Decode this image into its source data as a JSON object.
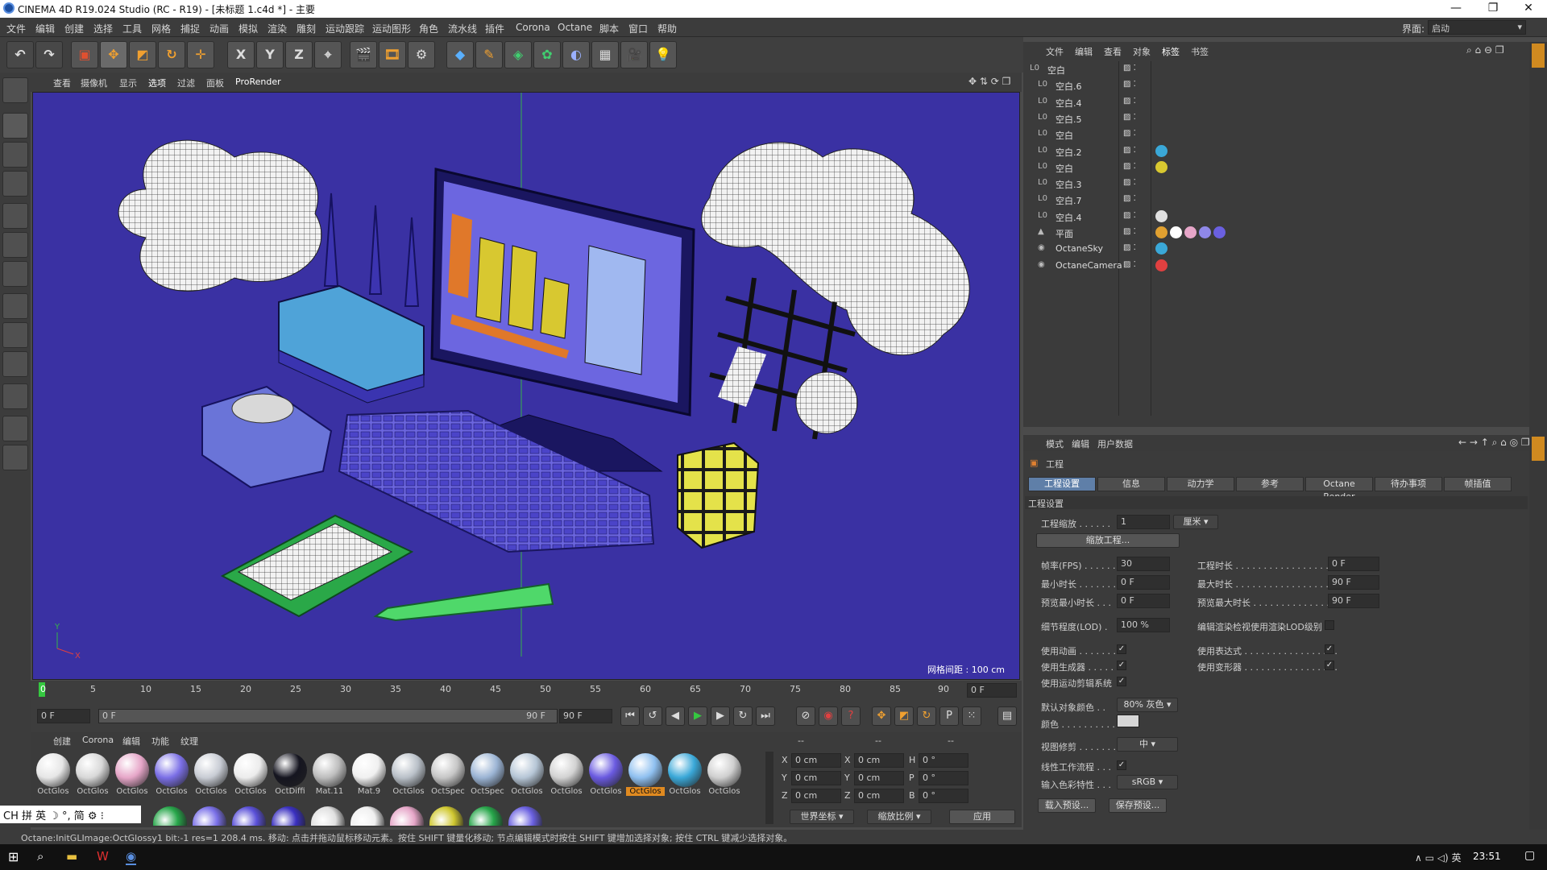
{
  "window": {
    "title": "CINEMA 4D R19.024 Studio (RC - R19) - [未标题 1.c4d *] - 主要",
    "minimize": "—",
    "maximize": "❐",
    "close": "✕"
  },
  "menu": [
    "文件",
    "编辑",
    "创建",
    "选择",
    "工具",
    "网格",
    "捕捉",
    "动画",
    "模拟",
    "渲染",
    "雕刻",
    "运动跟踪",
    "运动图形",
    "角色",
    "流水线",
    "插件",
    "Corona",
    "Octane",
    "脚本",
    "窗口",
    "帮助"
  ],
  "layout": {
    "label": "界面:",
    "value": "启动"
  },
  "toolbar": {
    "x": "X",
    "y": "Y",
    "z": "Z"
  },
  "viewport_menu": [
    "查看",
    "摄像机",
    "显示",
    "选项",
    "过滤",
    "面板",
    "ProRender"
  ],
  "viewport": {
    "grid_info": "网格间距 : 100 cm",
    "axis_y": "Y",
    "axis_x": "X"
  },
  "timeline": {
    "ticks": [
      "0",
      "5",
      "10",
      "15",
      "20",
      "25",
      "30",
      "35",
      "40",
      "45",
      "50",
      "55",
      "60",
      "65",
      "70",
      "75",
      "80",
      "85",
      "90"
    ],
    "end_frame": "0 F"
  },
  "controls": {
    "start": "0 F",
    "range_start": "0 F",
    "range_end": "90 F",
    "end": "90 F"
  },
  "material_menu": [
    "创建",
    "Corona",
    "编辑",
    "功能",
    "纹理"
  ],
  "materials": [
    {
      "label": "OctGlos",
      "color": "#e6e6e6"
    },
    {
      "label": "OctGlos",
      "color": "#d8d8d8"
    },
    {
      "label": "OctGlos",
      "color": "#e6a6c8"
    },
    {
      "label": "OctGlos",
      "color": "#7b6fe6"
    },
    {
      "label": "OctGlos",
      "color": "#c8ccd4"
    },
    {
      "label": "OctGlos",
      "color": "#ececec"
    },
    {
      "label": "OctDiffi",
      "color": "#151520"
    },
    {
      "label": "Mat.11",
      "color": "#bdbdbd"
    },
    {
      "label": "Mat.9",
      "color": "#f0f0f0"
    },
    {
      "label": "OctGlos",
      "color": "#b9c0c8"
    },
    {
      "label": "OctSpec",
      "color": "#c6c6c6"
    },
    {
      "label": "OctSpec",
      "color": "#9bb4d4"
    },
    {
      "label": "OctGlos",
      "color": "#b6c6d6"
    },
    {
      "label": "OctGlos",
      "color": "#d2d2d2"
    },
    {
      "label": "OctGlos",
      "color": "#6a5ae0"
    },
    {
      "label": "OctGlos",
      "color": "#8fc0f0"
    },
    {
      "label": "OctGlos",
      "color": "#3aa8d8"
    },
    {
      "label": "OctGlos",
      "color": "#cfcfcf"
    }
  ],
  "materials_row2": [
    "#27a64a",
    "#7a70e8",
    "#5a50d8",
    "#3a30c0",
    "#e0e0e0",
    "#f0f0f0",
    "#e6a6c8",
    "#d0c830",
    "#27a64a",
    "#6a60e0"
  ],
  "ime": "CH 拼 英 ☽ °, 简 ⚙ ⁝",
  "coords": {
    "hdr": [
      "--",
      "--",
      "--"
    ],
    "rows": [
      {
        "a": "X",
        "av": "0 cm",
        "b": "X",
        "bv": "0 cm",
        "c": "H",
        "cv": "0 °"
      },
      {
        "a": "Y",
        "av": "0 cm",
        "b": "Y",
        "bv": "0 cm",
        "c": "P",
        "cv": "0 °"
      },
      {
        "a": "Z",
        "av": "0 cm",
        "b": "Z",
        "bv": "0 cm",
        "c": "B",
        "cv": "0 °"
      }
    ],
    "world": "世界坐标",
    "scale": "缩放比例",
    "apply": "应用"
  },
  "object_menu": [
    "文件",
    "编辑",
    "查看",
    "对象",
    "标签",
    "书签"
  ],
  "objects": [
    {
      "name": "空白",
      "indent": 0
    },
    {
      "name": "空白.6",
      "indent": 1
    },
    {
      "name": "空白.4",
      "indent": 1
    },
    {
      "name": "空白.5",
      "indent": 1
    },
    {
      "name": "空白",
      "indent": 1
    },
    {
      "name": "空白.2",
      "indent": 1
    },
    {
      "name": "空白",
      "indent": 1
    },
    {
      "name": "空白.3",
      "indent": 1
    },
    {
      "name": "空白.7",
      "indent": 1
    },
    {
      "name": "空白.4",
      "indent": 1
    },
    {
      "name": "平面",
      "indent": 1
    },
    {
      "name": "OctaneSky",
      "indent": 1
    },
    {
      "name": "OctaneCamera",
      "indent": 1
    }
  ],
  "attr_menu": [
    "模式",
    "编辑",
    "用户数据"
  ],
  "attr": {
    "section": "工程",
    "tabs": [
      "工程设置",
      "信息",
      "动力学",
      "参考",
      "Octane Render",
      "待办事项",
      "帧插值"
    ],
    "group": "工程设置",
    "scale_label": "工程缩放 . . . . . .",
    "scale_val": "1",
    "unit": "厘米",
    "scale_btn": "缩放工程...",
    "fps_label": "帧率(FPS) . . . . . .",
    "fps": "30",
    "proj_time_label": "工程时长 . . . . . . . . . . . . . . . . . .",
    "proj_time": "0 F",
    "min_label": "最小时长 . . . . . . .",
    "min": "0 F",
    "max_label": "最大时长 . . . . . . . . . . . . . . . . . .",
    "max": "90 F",
    "pmin_label": "预览最小时长 . . .",
    "pmin": "0 F",
    "pmax_label": "预览最大时长 . . . . . . . . . . . . . . .",
    "pmax": "90 F",
    "lod_label": "细节程度(LOD) .",
    "lod": "100 %",
    "lod2": "编辑渲染检视使用渲染LOD级别",
    "c1": "使用动画 . . . . . . .",
    "c2": "使用表达式 . . . . . . . . . . . . . . . . .",
    "c3": "使用生成器 . . . . . .",
    "c4": "使用变形器 . . . . . . . . . . . . . . . . .",
    "c5": "使用运动剪辑系统",
    "defcol_label": "默认对象颜色 . .",
    "defcol": "80% 灰色",
    "color_label": "颜色 . . . . . . . . . . .",
    "clip_label": "视图修剪 . . . . . . .",
    "clip": "中",
    "linear_label": "线性工作流程 . . .",
    "input_label": "输入色彩特性 . . .",
    "input": "sRGB",
    "load": "载入预设...",
    "save": "保存预设..."
  },
  "status": "Octane:InitGLImage:OctGlossy1 bit:-1 res=1 208.4 ms.   移动: 点击并拖动鼠标移动元素。按住 SHIFT 键量化移动; 节点编辑模式时按住 SHIFT 键增加选择对象; 按住 CTRL 键减少选择对象。",
  "taskbar": {
    "time": "23:51"
  }
}
